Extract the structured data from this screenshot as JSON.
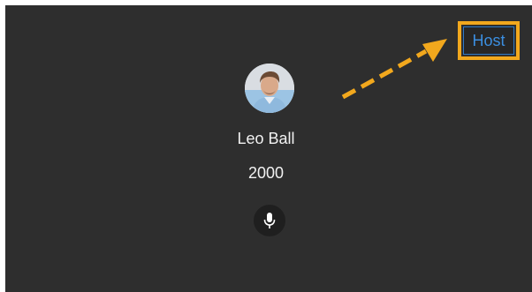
{
  "participant": {
    "name": "Leo Ball",
    "extension": "2000",
    "role_badge": "Host"
  },
  "icons": {
    "mic": "microphone-icon",
    "avatar": "user-avatar"
  },
  "colors": {
    "tile_background": "#2e2e2e",
    "badge_text": "#3b8ee0",
    "highlight": "#f2a81d"
  }
}
